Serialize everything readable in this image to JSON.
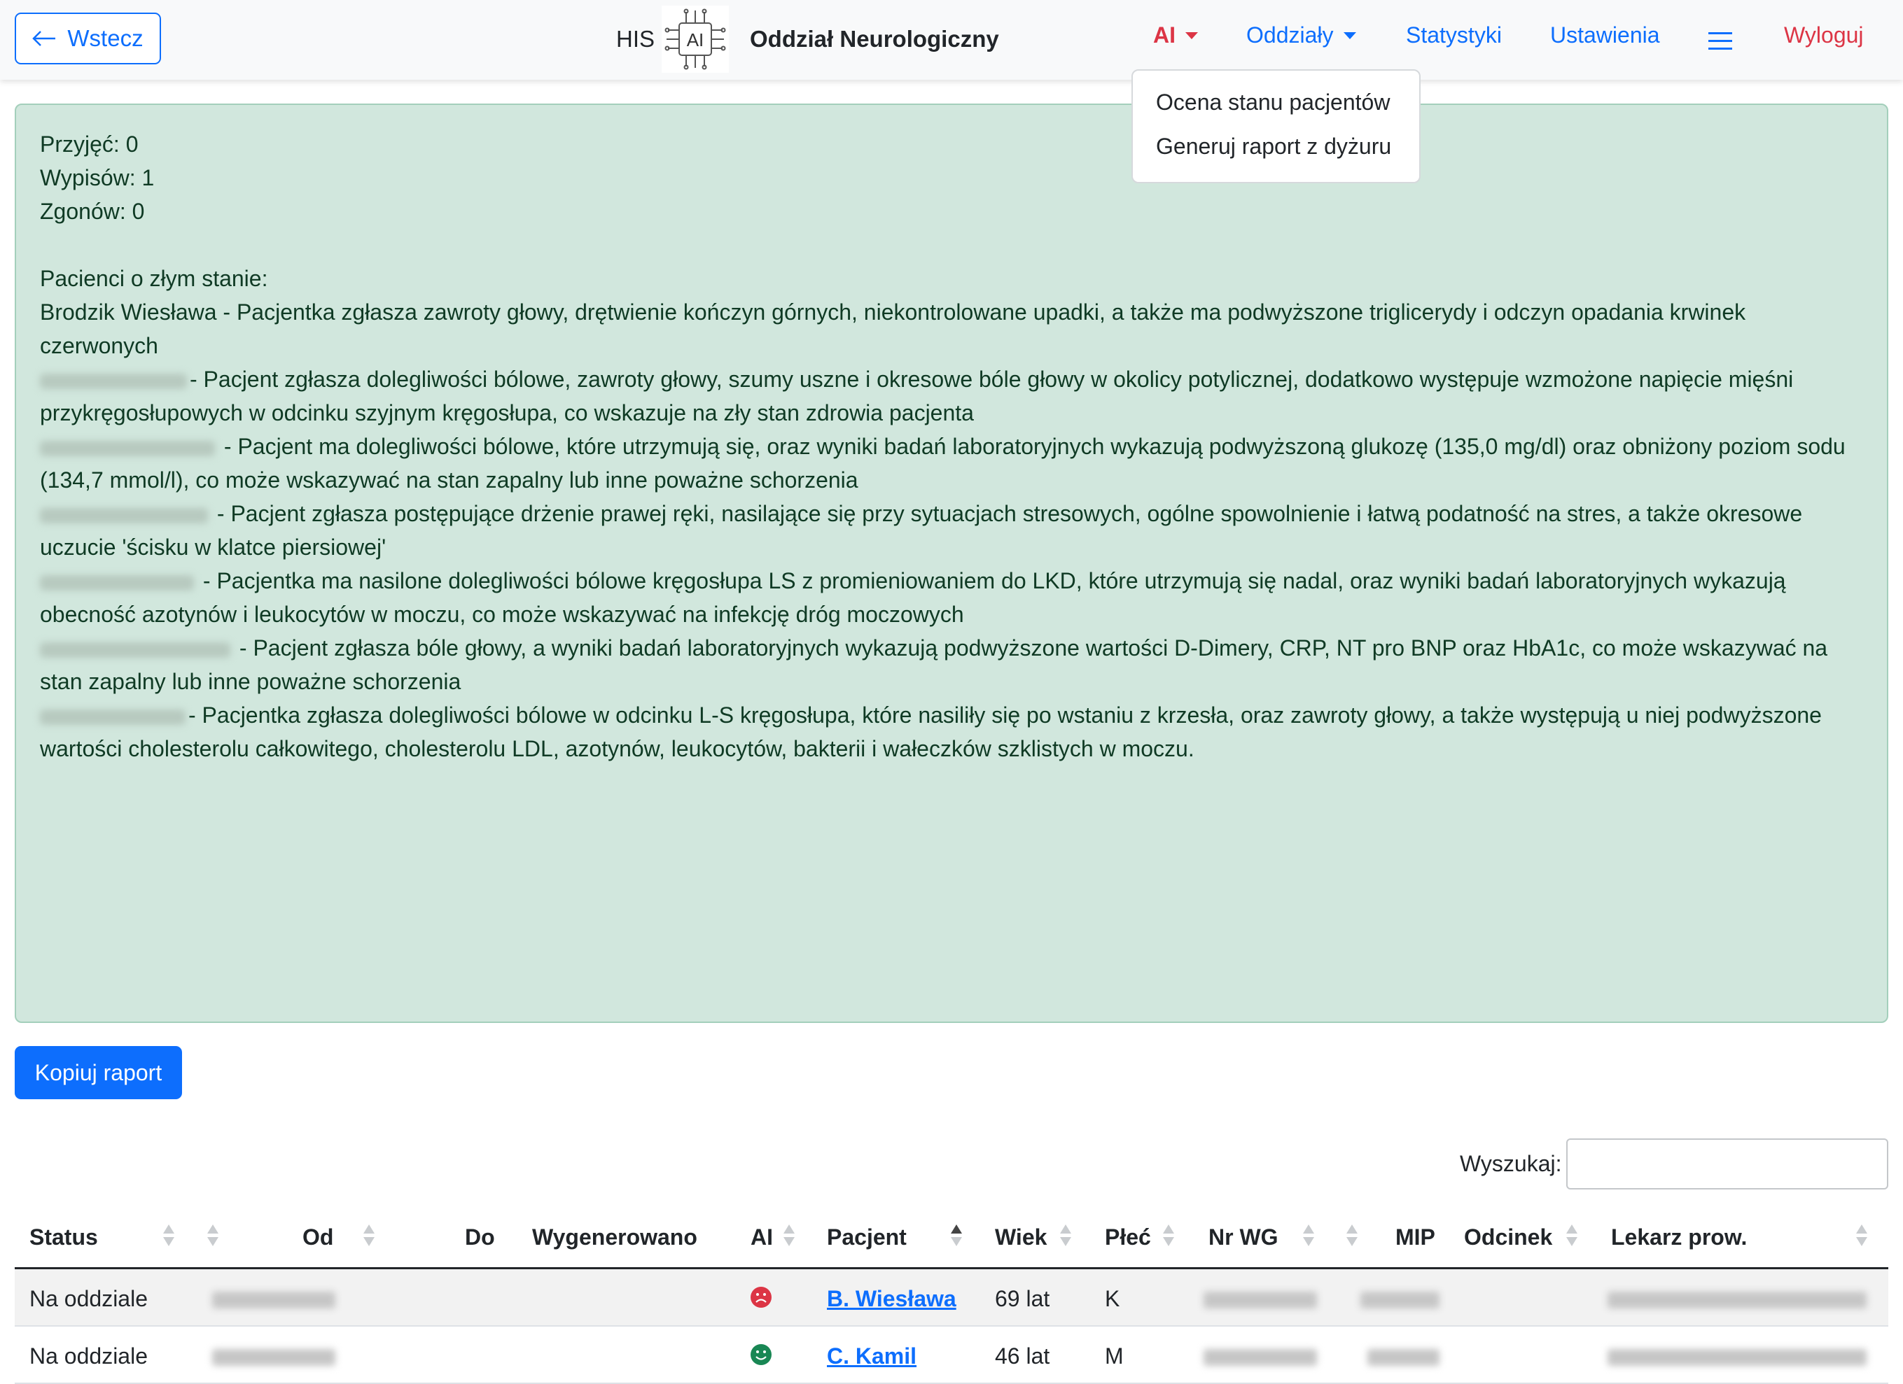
{
  "nav": {
    "back_label": "Wstecz",
    "his_label": "HIS",
    "logo_text": "AI",
    "department": "Oddział Neurologiczny",
    "items": {
      "ai": "AI",
      "oddzialy": "Oddziały",
      "statystyki": "Statystyki",
      "ustawienia": "Ustawienia",
      "wyloguj": "Wyloguj"
    },
    "ai_dropdown": [
      "Ocena stanu pacjentów",
      "Generuj raport z dyżuru"
    ]
  },
  "report": {
    "przyjec": "Przyjęć: 0",
    "wypisow": "Wypisów: 1",
    "zgonow": "Zgonów: 0",
    "heading": "Pacienci o złym stanie:",
    "entries": [
      "Brodzik Wiesława - Pacjentka zgłasza zawroty głowy, drętwienie kończyn górnych, niekontrolowane upadki, a także ma podwyższone triglicerydy i odczyn opadania krwinek czerwonych",
      "- Pacjent zgłasza dolegliwości bólowe, zawroty głowy, szumy uszne i okresowe bóle głowy w okolicy potylicznej, dodatkowo występuje wzmożone napięcie mięśni przykręgosłupowych w odcinku szyjnym kręgosłupa, co wskazuje na zły stan zdrowia pacjenta",
      "- Pacjent ma dolegliwości bólowe, które utrzymują się, oraz wyniki badań laboratoryjnych wykazują podwyższoną glukozę (135,0 mg/dl) oraz obniżony poziom sodu (134,7 mmol/l), co może wskazywać na stan zapalny lub inne poważne schorzenia",
      "- Pacjent zgłasza postępujące drżenie prawej ręki, nasilające się przy sytuacjach stresowych, ogólne spowolnienie i łatwą podatność na stres, a także okresowe uczucie 'ścisku w klatce piersiowej'",
      "- Pacjentka ma nasilone dolegliwości bólowe kręgosłupa LS z promieniowaniem do LKD, które utrzymują się nadal, oraz wyniki badań laboratoryjnych wykazują obecność azotynów i leukocytów w moczu, co może wskazywać na infekcję dróg moczowych",
      "- Pacjent zgłasza bóle głowy, a wyniki badań laboratoryjnych wykazują podwyższone wartości D-Dimery, CRP, NT pro BNP oraz HbA1c, co może wskazywać na stan zapalny lub inne poważne schorzenia",
      "- Pacjentka zgłasza dolegliwości bólowe w odcinku L-S kręgosłupa, które nasiliły się po wstaniu z krzesła, oraz zawroty głowy, a także występują u niej podwyższone wartości cholesterolu całkowitego, cholesterolu LDL, azotynów, leukocytów, bakterii i wałeczków szklistych w moczu."
    ]
  },
  "copy_label": "Kopiuj raport",
  "search": {
    "label": "Wyszukaj:",
    "value": ""
  },
  "table": {
    "headers": [
      "Status",
      "Od",
      "Do",
      "Wygenerowano",
      "AI",
      "Pacjent",
      "Wiek",
      "Płeć",
      "Nr WG",
      "MIP",
      "Odcinek",
      "Lekarz prow."
    ],
    "rows": [
      {
        "status": "Na oddziale",
        "ai": "sad",
        "pacjent": "B. Wiesława",
        "wiek": "69 lat",
        "plec": "K"
      },
      {
        "status": "Na oddziale",
        "ai": "happy",
        "pacjent": "C. Kamil",
        "wiek": "46 lat",
        "plec": "M"
      }
    ]
  },
  "colors": {
    "primary": "#0d6efd",
    "danger": "#dc3545",
    "success_bg": "#d1e7dd",
    "happy": "#198754"
  },
  "icons": [
    "arrow-left-icon",
    "ai-chip-logo",
    "caret-down-icon",
    "hamburger-icon",
    "sort-icon",
    "sad-face-icon",
    "happy-face-icon"
  ]
}
